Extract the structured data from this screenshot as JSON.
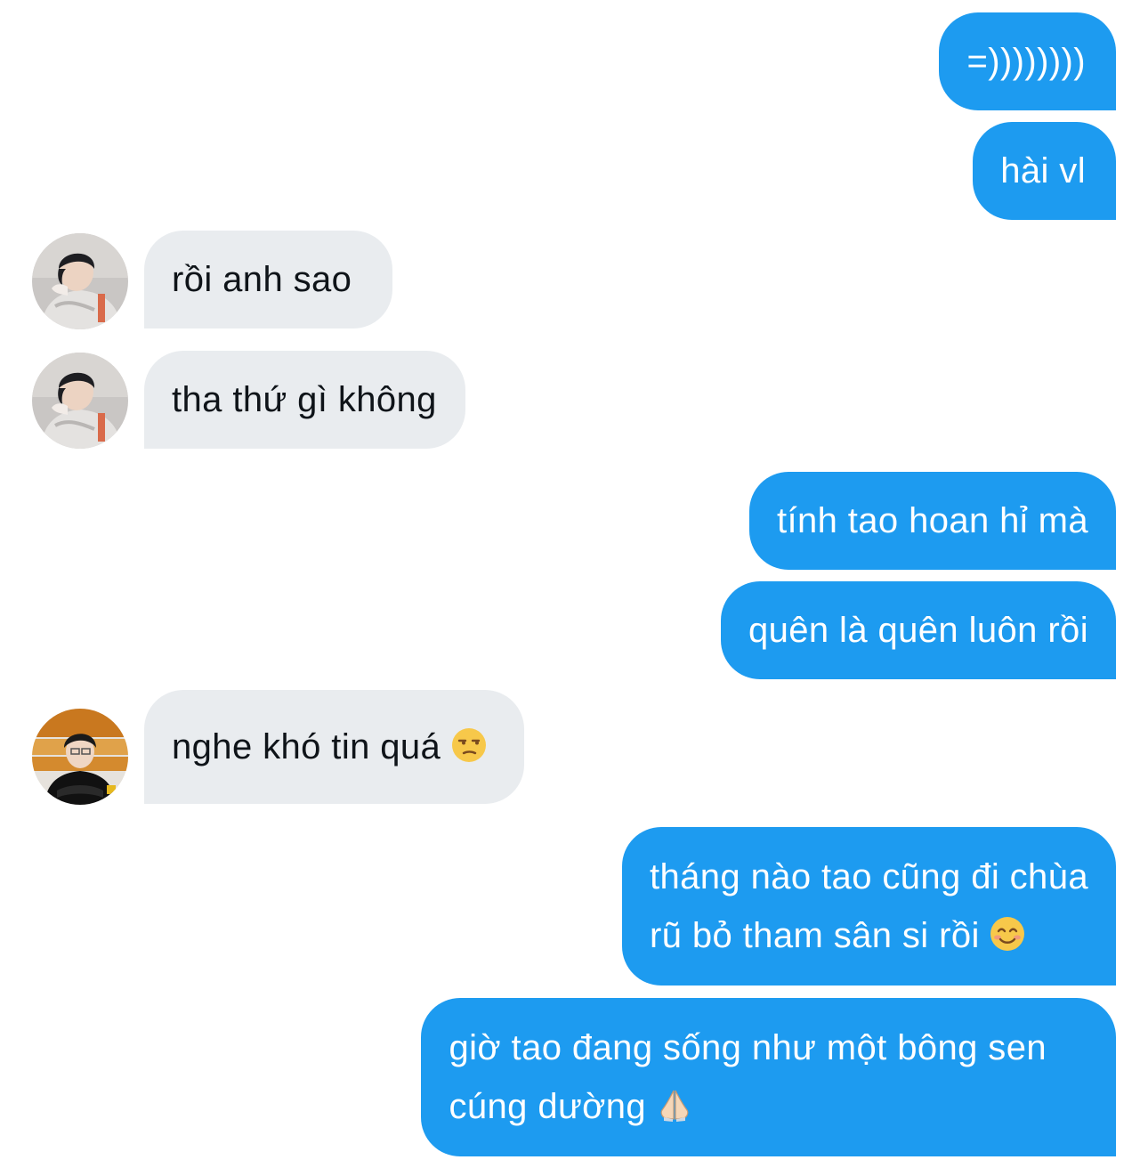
{
  "messages": [
    {
      "id": "m1",
      "direction": "outgoing",
      "text": "=))))))))"
    },
    {
      "id": "m2",
      "direction": "outgoing",
      "text": "hài vl"
    },
    {
      "id": "m3",
      "direction": "incoming",
      "text": "rồi anh sao"
    },
    {
      "id": "m4",
      "direction": "incoming",
      "text": "tha thứ gì không"
    },
    {
      "id": "m5",
      "direction": "outgoing",
      "text": "tính tao hoan hỉ mà"
    },
    {
      "id": "m6",
      "direction": "outgoing",
      "text": "quên là quên luôn rồi"
    },
    {
      "id": "m7",
      "direction": "incoming",
      "text": "nghe khó tin quá",
      "emoji": "unamused-face-emoji"
    },
    {
      "id": "m8",
      "direction": "outgoing",
      "lines": [
        "tháng nào tao cũng đi chùa",
        "rũ bỏ tham sân si rồi"
      ],
      "emoji": "smiling-face-emoji"
    },
    {
      "id": "m9",
      "direction": "outgoing",
      "lines": [
        "giờ tao đang sống như một bông sen",
        "cúng dường"
      ],
      "emoji": "folded-hands-emoji"
    }
  ],
  "colors": {
    "outgoing_bubble": "#1d9bf0",
    "incoming_bubble": "#e9ecef",
    "outgoing_text": "#ffffff",
    "incoming_text": "#0f1419"
  }
}
